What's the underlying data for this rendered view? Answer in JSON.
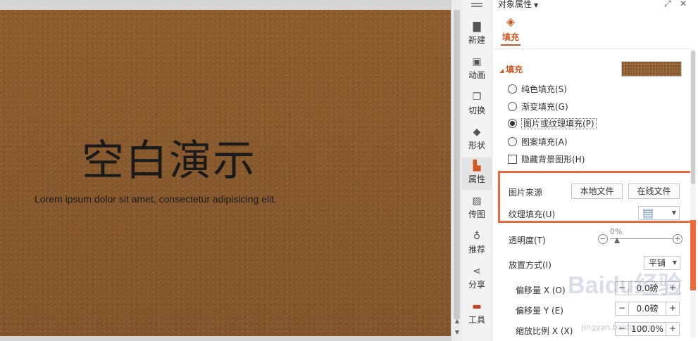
{
  "slide": {
    "title": "空白演示",
    "subtitle": "Lorem ipsum dolor sit amet, consectetur adipisicing elit."
  },
  "toolbar": {
    "items": [
      {
        "label": "新建",
        "icon": "new-file-icon"
      },
      {
        "label": "动画",
        "icon": "animation-icon"
      },
      {
        "label": "切换",
        "icon": "transition-icon"
      },
      {
        "label": "形状",
        "icon": "shape-icon"
      },
      {
        "label": "属性",
        "icon": "properties-icon",
        "active": true
      },
      {
        "label": "传图",
        "icon": "upload-image-icon"
      },
      {
        "label": "推荐",
        "icon": "recommend-icon"
      },
      {
        "label": "分享",
        "icon": "share-icon"
      },
      {
        "label": "工具",
        "icon": "toolbox-icon"
      }
    ]
  },
  "panel": {
    "title": "对象属性",
    "tab": "填充",
    "section": "填充",
    "options": [
      {
        "label": "纯色填充(S)"
      },
      {
        "label": "渐变填充(G)"
      },
      {
        "label": "图片或纹理填充(P)",
        "checked": true
      },
      {
        "label": "图案填充(A)"
      }
    ],
    "hide_bg": "隐藏背景图形(H)",
    "image_source_label": "图片来源",
    "local_file": "本地文件",
    "online_file": "在线文件",
    "texture_label": "纹理填充(U)",
    "transparency_label": "透明度(T)",
    "transparency_value": "0%",
    "placement_label": "放置方式(I)",
    "placement_value": "平铺",
    "offset_x_label": "偏移量 X (O)",
    "offset_x_value": "0.0磅",
    "offset_y_label": "偏移量 Y (E)",
    "offset_y_value": "0.0磅",
    "scale_x_label": "缩放比例 X (X)",
    "scale_x_value": "100.0%"
  },
  "watermark": {
    "main": "Baidu经验",
    "sub": "jingyan.baidu.com"
  },
  "colors": {
    "accent": "#d0581f",
    "highlight": "#ee6a3a",
    "slide_bg": "#8a5a2b"
  }
}
